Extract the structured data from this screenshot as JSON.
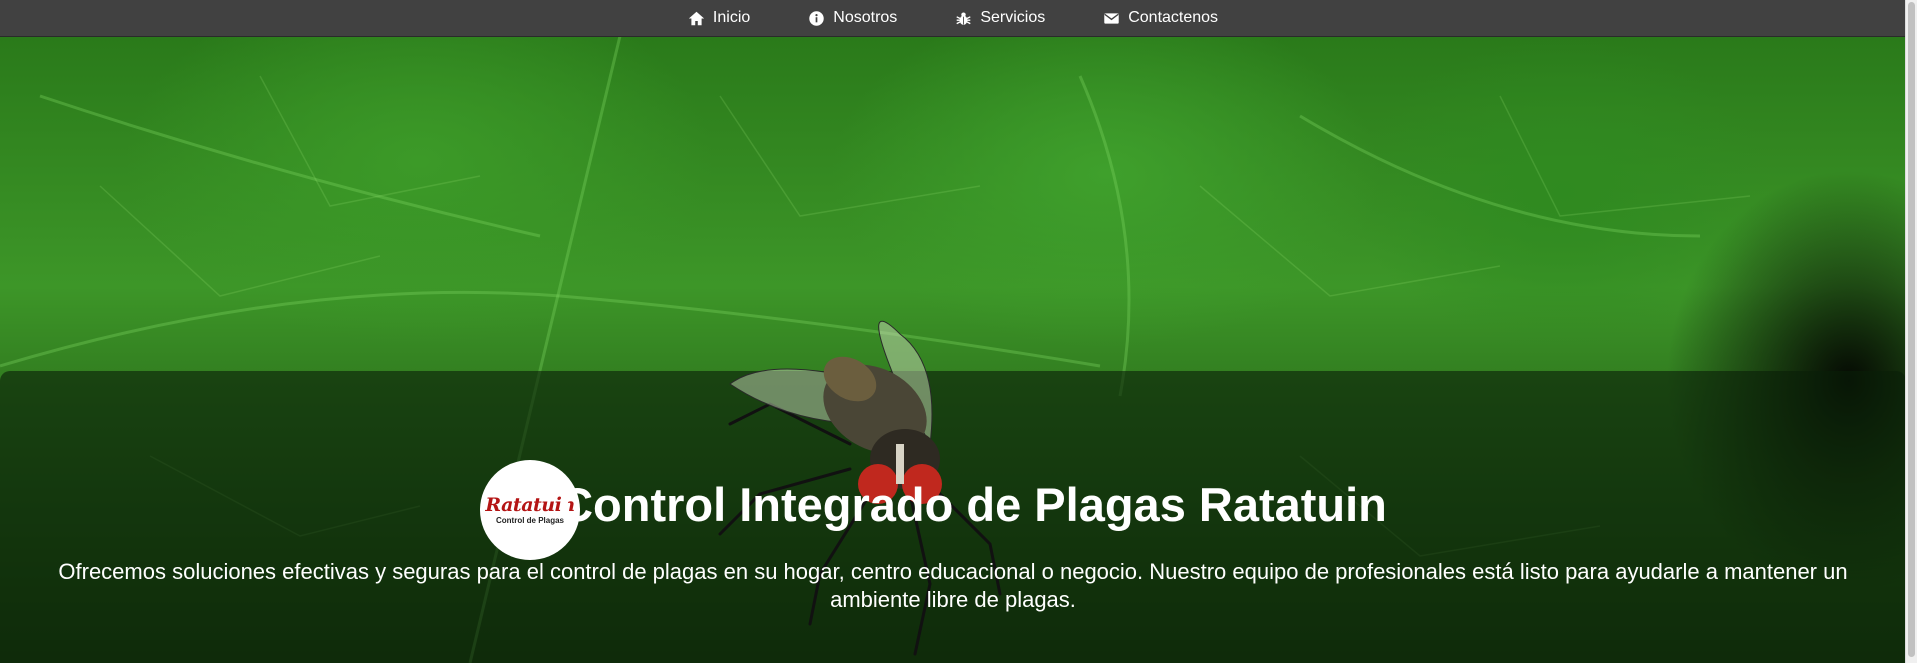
{
  "nav": {
    "items": [
      {
        "label": "Inicio",
        "icon": "home-icon"
      },
      {
        "label": "Nosotros",
        "icon": "info-icon"
      },
      {
        "label": "Servicios",
        "icon": "bug-icon"
      },
      {
        "label": "Contactenos",
        "icon": "envelope-icon"
      }
    ]
  },
  "hero": {
    "logo_brand": "Ratatuin",
    "logo_sub": "Control de Plagas",
    "title": "Control Integrado de Plagas Ratatuin",
    "description": "Ofrecemos soluciones efectivas y seguras para el control de plagas en su hogar, centro educacional o negocio. Nuestro equipo de profesionales está listo para ayudarle a mantener un ambiente libre de plagas."
  },
  "colors": {
    "nav_background": "#414141",
    "nav_text": "#ffffff",
    "logo_brand": "#b41414",
    "hero_text": "#ffffff"
  }
}
